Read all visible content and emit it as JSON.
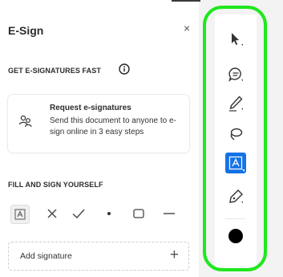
{
  "panel": {
    "title": "E-Sign",
    "close_glyph": "×",
    "section_fast": "GET E-SIGNATURES FAST",
    "card": {
      "title": "Request e-signatures",
      "description": "Send this document to anyone to e-sign online in 3 easy steps",
      "icon": "people-icon"
    },
    "section_self": "FILL AND SIGN YOURSELF",
    "tools": [
      {
        "name": "text-field-tool",
        "icon": "text-field-icon"
      },
      {
        "name": "cross-mark-tool",
        "icon": "cross-icon"
      },
      {
        "name": "check-mark-tool",
        "icon": "check-icon"
      },
      {
        "name": "dot-tool",
        "icon": "dot-icon"
      },
      {
        "name": "rectangle-tool",
        "icon": "rectangle-icon"
      },
      {
        "name": "line-tool",
        "icon": "line-icon"
      }
    ],
    "add_signature": "Add signature",
    "add_glyph": "+"
  },
  "toolbar": {
    "tools": [
      {
        "name": "select-tool",
        "icon": "arrow-cursor-icon"
      },
      {
        "name": "comment-tool",
        "icon": "comment-icon"
      },
      {
        "name": "draw-tool",
        "icon": "pencil-icon"
      },
      {
        "name": "lasso-tool",
        "icon": "lasso-icon"
      },
      {
        "name": "text-field-tool",
        "icon": "text-field-icon",
        "active": true
      },
      {
        "name": "sign-tool",
        "icon": "pen-nib-icon"
      }
    ],
    "current_color": "#000000",
    "accent": "#1473e6",
    "highlight_ring": "#1ee81e"
  }
}
